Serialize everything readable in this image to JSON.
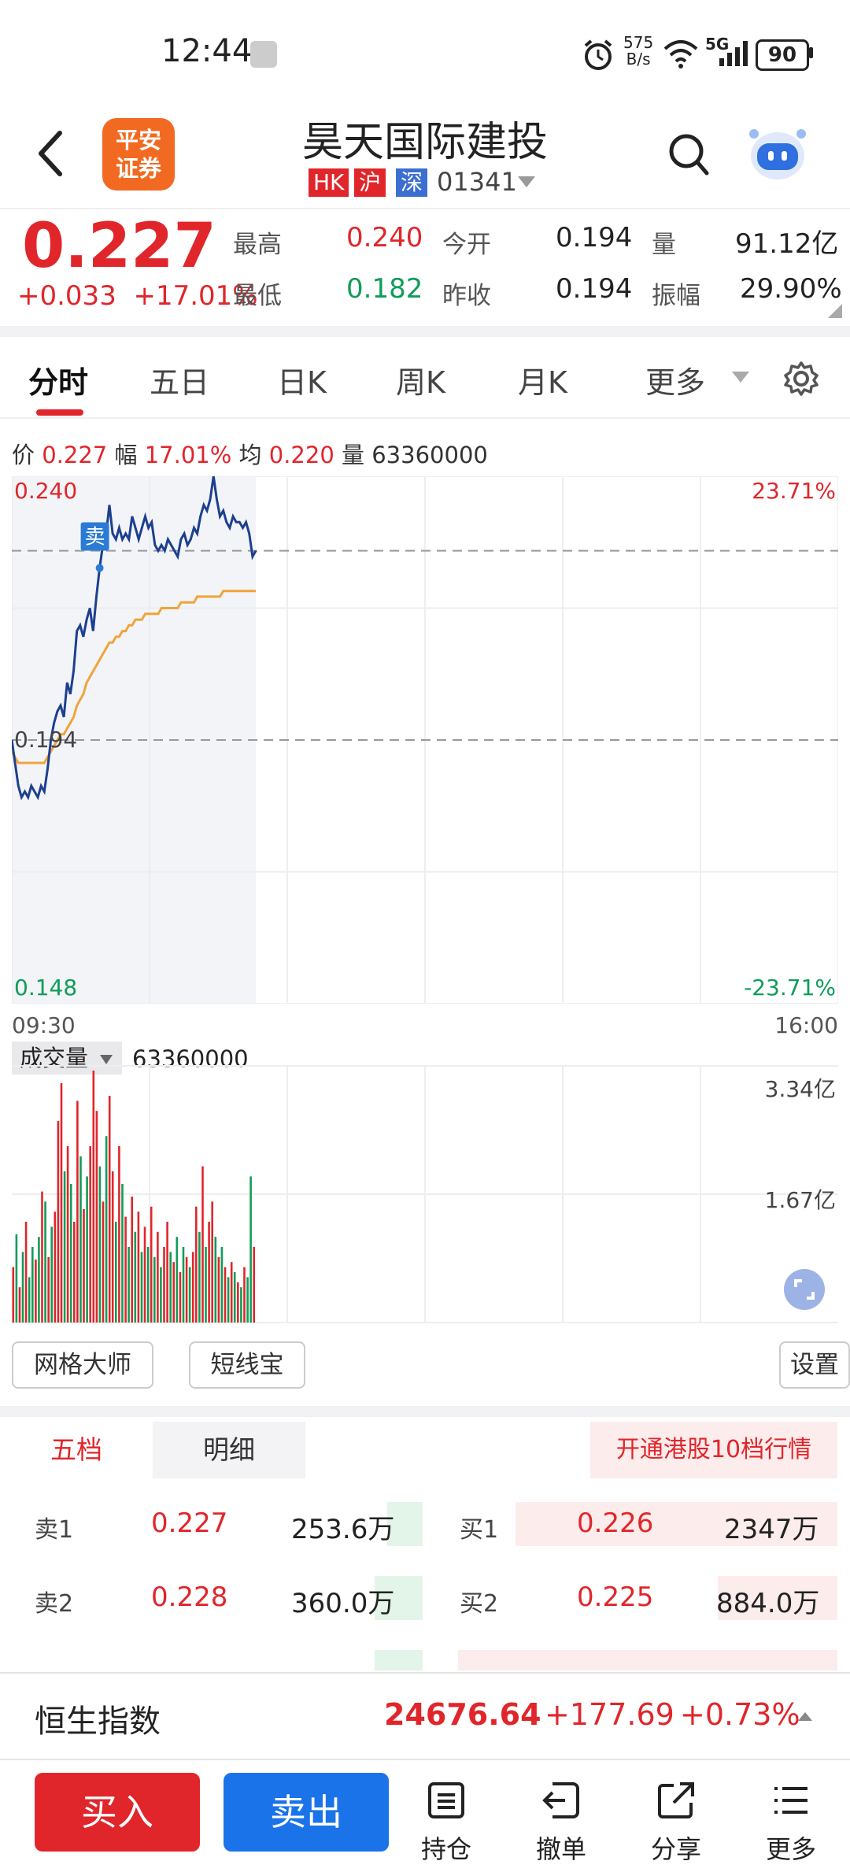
{
  "status_bar": {
    "time": "12:44",
    "net_speed_value": "575",
    "net_speed_unit": "B/s",
    "network": "5G",
    "battery": "90"
  },
  "header": {
    "logo_line1": "平安",
    "logo_line2": "证券",
    "stock_name": "昊天国际建投",
    "tags": [
      "HK",
      "沪",
      "深"
    ],
    "tag_colors": [
      "#e0262b",
      "#e0262b",
      "#3b6fd1"
    ],
    "stock_code": "01341"
  },
  "quote": {
    "price": "0.227",
    "change": "+0.033",
    "change_pct": "+17.01%",
    "high_label": "最高",
    "high": "0.240",
    "low_label": "最低",
    "low": "0.182",
    "open_label": "今开",
    "open": "0.194",
    "prev_close_label": "昨收",
    "prev_close": "0.194",
    "volume_label": "量",
    "volume": "91.12亿",
    "amplitude_label": "振幅",
    "amplitude": "29.90%"
  },
  "tabs": [
    "分时",
    "五日",
    "日K",
    "周K",
    "月K",
    "更多"
  ],
  "info_line": {
    "price_label": "价",
    "price": "0.227",
    "change_label": "幅",
    "change": "17.01%",
    "avg_label": "均",
    "avg": "0.220",
    "vol_label": "量",
    "vol": "63360000"
  },
  "chart_axes": {
    "top_price": "0.240",
    "top_pct": "23.71%",
    "mid_price": "0.194",
    "bottom_price": "0.148",
    "bottom_pct": "-23.71%",
    "time_start": "09:30",
    "time_end": "16:00",
    "sell_marker": "卖"
  },
  "volume_panel": {
    "selector_label": "成交量",
    "value": "63360000",
    "top_label": "3.34亿",
    "mid_label": "1.67亿"
  },
  "tools": {
    "grid_master": "网格大师",
    "short_line": "短线宝",
    "settings": "设置"
  },
  "order_book": {
    "tab_five": "五档",
    "tab_detail": "明细",
    "promo": "开通港股10档行情",
    "sell": [
      {
        "label": "卖1",
        "price": "0.227",
        "vol": "253.6万"
      },
      {
        "label": "卖2",
        "price": "0.228",
        "vol": "360.0万"
      }
    ],
    "buy": [
      {
        "label": "买1",
        "price": "0.226",
        "vol": "2347万"
      },
      {
        "label": "买2",
        "price": "0.225",
        "vol": "884.0万"
      }
    ]
  },
  "index_bar": {
    "name": "恒生指数",
    "value": "24676.64",
    "change": "+177.69",
    "change_pct": "+0.73%"
  },
  "bottom_bar": {
    "buy": "买入",
    "sell": "卖出",
    "holdings": "持仓",
    "cancel": "撤单",
    "share": "分享",
    "more": "更多"
  },
  "colors": {
    "up": "#e0262b",
    "down": "#0f9d58",
    "price_line": "#1d3f8f",
    "avg_line": "#f0a43a",
    "buy_button": "#e0262b",
    "sell_button": "#1a73e8"
  },
  "chart_data": {
    "type": "line",
    "time_range": [
      "09:30",
      "16:00"
    ],
    "ylim": [
      0.148,
      0.24
    ],
    "prev_close": 0.194,
    "series": [
      {
        "values": [
          0.194,
          0.19,
          0.186,
          0.184,
          0.185,
          0.184,
          0.186,
          0.185,
          0.184,
          0.186,
          0.185,
          0.189,
          0.194,
          0.197,
          0.199,
          0.2,
          0.198,
          0.204,
          0.202,
          0.206,
          0.213,
          0.214,
          0.212,
          0.215,
          0.217,
          0.213,
          0.219,
          0.224,
          0.228,
          0.23,
          0.235,
          0.23,
          0.229,
          0.231,
          0.229,
          0.23,
          0.229,
          0.233,
          0.231,
          0.229,
          0.231,
          0.233,
          0.231,
          0.232,
          0.228,
          0.227,
          0.228,
          0.227,
          0.229,
          0.228,
          0.227,
          0.226,
          0.229,
          0.23,
          0.228,
          0.229,
          0.231,
          0.23,
          0.233,
          0.235,
          0.234,
          0.236,
          0.24,
          0.236,
          0.233,
          0.234,
          0.232,
          0.231,
          0.233,
          0.232,
          0.232,
          0.231,
          0.232,
          0.23,
          0.226,
          0.227
        ]
      },
      {
        "values": [
          0.192,
          0.191,
          0.19,
          0.19,
          0.19,
          0.19,
          0.19,
          0.19,
          0.19,
          0.19,
          0.19,
          0.191,
          0.192,
          0.193,
          0.194,
          0.195,
          0.195,
          0.196,
          0.197,
          0.198,
          0.2,
          0.201,
          0.202,
          0.204,
          0.205,
          0.206,
          0.207,
          0.208,
          0.209,
          0.21,
          0.211,
          0.211,
          0.212,
          0.212,
          0.213,
          0.213,
          0.214,
          0.214,
          0.215,
          0.215,
          0.215,
          0.216,
          0.216,
          0.216,
          0.216,
          0.216,
          0.217,
          0.217,
          0.217,
          0.217,
          0.217,
          0.217,
          0.218,
          0.218,
          0.218,
          0.218,
          0.218,
          0.219,
          0.219,
          0.219,
          0.219,
          0.219,
          0.219,
          0.219,
          0.219,
          0.22,
          0.22,
          0.22,
          0.22,
          0.22,
          0.22,
          0.22,
          0.22,
          0.22,
          0.22,
          0.22
        ]
      }
    ],
    "volume": {
      "ylim": [
        0,
        334000000
      ],
      "values": [
        22,
        35,
        14,
        28,
        40,
        18,
        30,
        25,
        34,
        52,
        48,
        26,
        38,
        44,
        80,
        95,
        60,
        70,
        55,
        40,
        88,
        66,
        45,
        58,
        70,
        100,
        84,
        62,
        48,
        74,
        90,
        60,
        40,
        70,
        55,
        42,
        30,
        50,
        36,
        44,
        28,
        38,
        30,
        46,
        26,
        36,
        22,
        30,
        40,
        28,
        24,
        34,
        20,
        30,
        26,
        22,
        28,
        46,
        36,
        62,
        30,
        40,
        48,
        34,
        26,
        30,
        22,
        18,
        24,
        20,
        16,
        14,
        22,
        18,
        58,
        30
      ],
      "directions": [
        1,
        0,
        1,
        0,
        1,
        0,
        0,
        1,
        0,
        1,
        0,
        1,
        0,
        1,
        1,
        1,
        0,
        1,
        0,
        1,
        1,
        0,
        1,
        0,
        1,
        1,
        1,
        0,
        1,
        0,
        1,
        1,
        0,
        1,
        0,
        1,
        0,
        1,
        0,
        1,
        0,
        1,
        0,
        1,
        0,
        1,
        0,
        1,
        1,
        0,
        1,
        0,
        1,
        0,
        1,
        0,
        1,
        1,
        0,
        1,
        0,
        1,
        1,
        0,
        1,
        0,
        1,
        0,
        1,
        0,
        1,
        0,
        1,
        0,
        0,
        1
      ]
    }
  }
}
